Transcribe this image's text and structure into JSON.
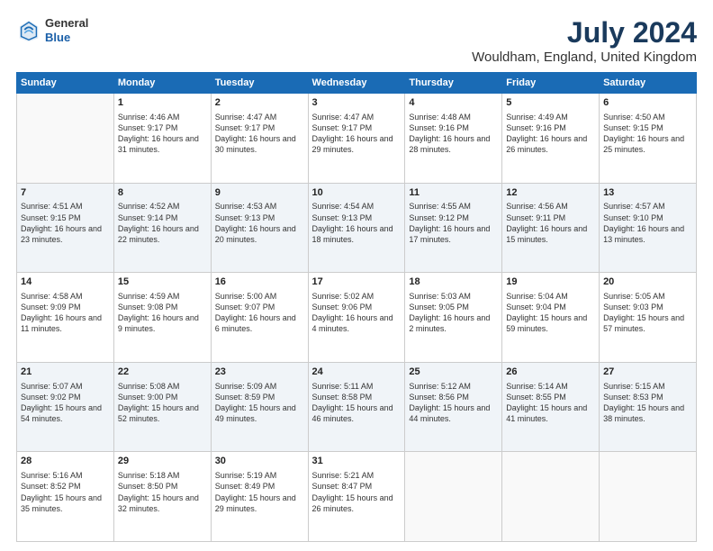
{
  "header": {
    "logo_general": "General",
    "logo_blue": "Blue",
    "title": "July 2024",
    "location": "Wouldham, England, United Kingdom"
  },
  "days_of_week": [
    "Sunday",
    "Monday",
    "Tuesday",
    "Wednesday",
    "Thursday",
    "Friday",
    "Saturday"
  ],
  "weeks": [
    [
      {
        "day": "",
        "empty": true
      },
      {
        "day": "1",
        "sunrise": "Sunrise: 4:46 AM",
        "sunset": "Sunset: 9:17 PM",
        "daylight": "Daylight: 16 hours and 31 minutes."
      },
      {
        "day": "2",
        "sunrise": "Sunrise: 4:47 AM",
        "sunset": "Sunset: 9:17 PM",
        "daylight": "Daylight: 16 hours and 30 minutes."
      },
      {
        "day": "3",
        "sunrise": "Sunrise: 4:47 AM",
        "sunset": "Sunset: 9:17 PM",
        "daylight": "Daylight: 16 hours and 29 minutes."
      },
      {
        "day": "4",
        "sunrise": "Sunrise: 4:48 AM",
        "sunset": "Sunset: 9:16 PM",
        "daylight": "Daylight: 16 hours and 28 minutes."
      },
      {
        "day": "5",
        "sunrise": "Sunrise: 4:49 AM",
        "sunset": "Sunset: 9:16 PM",
        "daylight": "Daylight: 16 hours and 26 minutes."
      },
      {
        "day": "6",
        "sunrise": "Sunrise: 4:50 AM",
        "sunset": "Sunset: 9:15 PM",
        "daylight": "Daylight: 16 hours and 25 minutes."
      }
    ],
    [
      {
        "day": "7",
        "sunrise": "Sunrise: 4:51 AM",
        "sunset": "Sunset: 9:15 PM",
        "daylight": "Daylight: 16 hours and 23 minutes."
      },
      {
        "day": "8",
        "sunrise": "Sunrise: 4:52 AM",
        "sunset": "Sunset: 9:14 PM",
        "daylight": "Daylight: 16 hours and 22 minutes."
      },
      {
        "day": "9",
        "sunrise": "Sunrise: 4:53 AM",
        "sunset": "Sunset: 9:13 PM",
        "daylight": "Daylight: 16 hours and 20 minutes."
      },
      {
        "day": "10",
        "sunrise": "Sunrise: 4:54 AM",
        "sunset": "Sunset: 9:13 PM",
        "daylight": "Daylight: 16 hours and 18 minutes."
      },
      {
        "day": "11",
        "sunrise": "Sunrise: 4:55 AM",
        "sunset": "Sunset: 9:12 PM",
        "daylight": "Daylight: 16 hours and 17 minutes."
      },
      {
        "day": "12",
        "sunrise": "Sunrise: 4:56 AM",
        "sunset": "Sunset: 9:11 PM",
        "daylight": "Daylight: 16 hours and 15 minutes."
      },
      {
        "day": "13",
        "sunrise": "Sunrise: 4:57 AM",
        "sunset": "Sunset: 9:10 PM",
        "daylight": "Daylight: 16 hours and 13 minutes."
      }
    ],
    [
      {
        "day": "14",
        "sunrise": "Sunrise: 4:58 AM",
        "sunset": "Sunset: 9:09 PM",
        "daylight": "Daylight: 16 hours and 11 minutes."
      },
      {
        "day": "15",
        "sunrise": "Sunrise: 4:59 AM",
        "sunset": "Sunset: 9:08 PM",
        "daylight": "Daylight: 16 hours and 9 minutes."
      },
      {
        "day": "16",
        "sunrise": "Sunrise: 5:00 AM",
        "sunset": "Sunset: 9:07 PM",
        "daylight": "Daylight: 16 hours and 6 minutes."
      },
      {
        "day": "17",
        "sunrise": "Sunrise: 5:02 AM",
        "sunset": "Sunset: 9:06 PM",
        "daylight": "Daylight: 16 hours and 4 minutes."
      },
      {
        "day": "18",
        "sunrise": "Sunrise: 5:03 AM",
        "sunset": "Sunset: 9:05 PM",
        "daylight": "Daylight: 16 hours and 2 minutes."
      },
      {
        "day": "19",
        "sunrise": "Sunrise: 5:04 AM",
        "sunset": "Sunset: 9:04 PM",
        "daylight": "Daylight: 15 hours and 59 minutes."
      },
      {
        "day": "20",
        "sunrise": "Sunrise: 5:05 AM",
        "sunset": "Sunset: 9:03 PM",
        "daylight": "Daylight: 15 hours and 57 minutes."
      }
    ],
    [
      {
        "day": "21",
        "sunrise": "Sunrise: 5:07 AM",
        "sunset": "Sunset: 9:02 PM",
        "daylight": "Daylight: 15 hours and 54 minutes."
      },
      {
        "day": "22",
        "sunrise": "Sunrise: 5:08 AM",
        "sunset": "Sunset: 9:00 PM",
        "daylight": "Daylight: 15 hours and 52 minutes."
      },
      {
        "day": "23",
        "sunrise": "Sunrise: 5:09 AM",
        "sunset": "Sunset: 8:59 PM",
        "daylight": "Daylight: 15 hours and 49 minutes."
      },
      {
        "day": "24",
        "sunrise": "Sunrise: 5:11 AM",
        "sunset": "Sunset: 8:58 PM",
        "daylight": "Daylight: 15 hours and 46 minutes."
      },
      {
        "day": "25",
        "sunrise": "Sunrise: 5:12 AM",
        "sunset": "Sunset: 8:56 PM",
        "daylight": "Daylight: 15 hours and 44 minutes."
      },
      {
        "day": "26",
        "sunrise": "Sunrise: 5:14 AM",
        "sunset": "Sunset: 8:55 PM",
        "daylight": "Daylight: 15 hours and 41 minutes."
      },
      {
        "day": "27",
        "sunrise": "Sunrise: 5:15 AM",
        "sunset": "Sunset: 8:53 PM",
        "daylight": "Daylight: 15 hours and 38 minutes."
      }
    ],
    [
      {
        "day": "28",
        "sunrise": "Sunrise: 5:16 AM",
        "sunset": "Sunset: 8:52 PM",
        "daylight": "Daylight: 15 hours and 35 minutes."
      },
      {
        "day": "29",
        "sunrise": "Sunrise: 5:18 AM",
        "sunset": "Sunset: 8:50 PM",
        "daylight": "Daylight: 15 hours and 32 minutes."
      },
      {
        "day": "30",
        "sunrise": "Sunrise: 5:19 AM",
        "sunset": "Sunset: 8:49 PM",
        "daylight": "Daylight: 15 hours and 29 minutes."
      },
      {
        "day": "31",
        "sunrise": "Sunrise: 5:21 AM",
        "sunset": "Sunset: 8:47 PM",
        "daylight": "Daylight: 15 hours and 26 minutes."
      },
      {
        "day": "",
        "empty": true
      },
      {
        "day": "",
        "empty": true
      },
      {
        "day": "",
        "empty": true
      }
    ]
  ]
}
